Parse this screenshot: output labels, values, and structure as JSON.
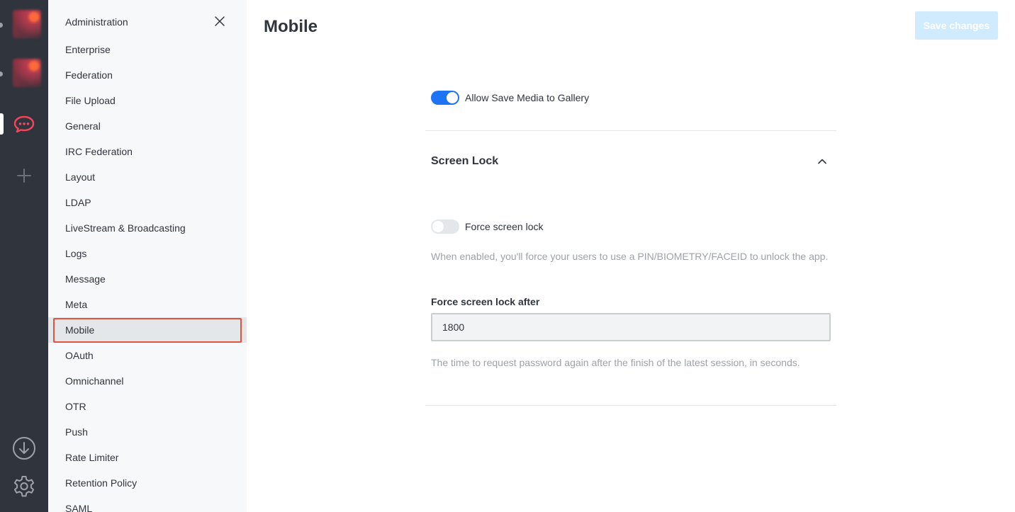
{
  "sidebar": {
    "title": "Administration",
    "items": [
      {
        "label": "Enterprise"
      },
      {
        "label": "Federation"
      },
      {
        "label": "File Upload"
      },
      {
        "label": "General"
      },
      {
        "label": "IRC Federation"
      },
      {
        "label": "Layout"
      },
      {
        "label": "LDAP"
      },
      {
        "label": "LiveStream & Broadcasting"
      },
      {
        "label": "Logs"
      },
      {
        "label": "Message"
      },
      {
        "label": "Meta"
      },
      {
        "label": "Mobile",
        "selected": true
      },
      {
        "label": "OAuth"
      },
      {
        "label": "Omnichannel"
      },
      {
        "label": "OTR"
      },
      {
        "label": "Push"
      },
      {
        "label": "Rate Limiter"
      },
      {
        "label": "Retention Policy"
      },
      {
        "label": "SAML"
      }
    ]
  },
  "main": {
    "title": "Mobile",
    "save_label": "Save changes",
    "allow_save_media": {
      "label": "Allow Save Media to Gallery",
      "enabled": true
    },
    "screen_lock": {
      "title": "Screen Lock",
      "force_lock": {
        "label": "Force screen lock",
        "enabled": false
      },
      "force_lock_hint": "When enabled, you'll force your users to use a PIN/BIOMETRY/FACEID to unlock the app.",
      "lock_after_label": "Force screen lock after",
      "lock_after_value": "1800",
      "lock_after_hint": "The time to request password again after the finish of the latest session, in seconds."
    }
  },
  "icons": {
    "rail": [
      "server-avatar",
      "server-avatar",
      "rocket-chat-icon",
      "plus-icon",
      "download-icon",
      "gear-icon"
    ],
    "close": "close-icon",
    "collapse": "chevron-up-icon"
  },
  "colors": {
    "accent": "#1d74f5",
    "brand": "#f5455c",
    "rail_bg": "#2f343d",
    "save_disabled": "#d1ebfe",
    "highlight": "#e0543f"
  }
}
